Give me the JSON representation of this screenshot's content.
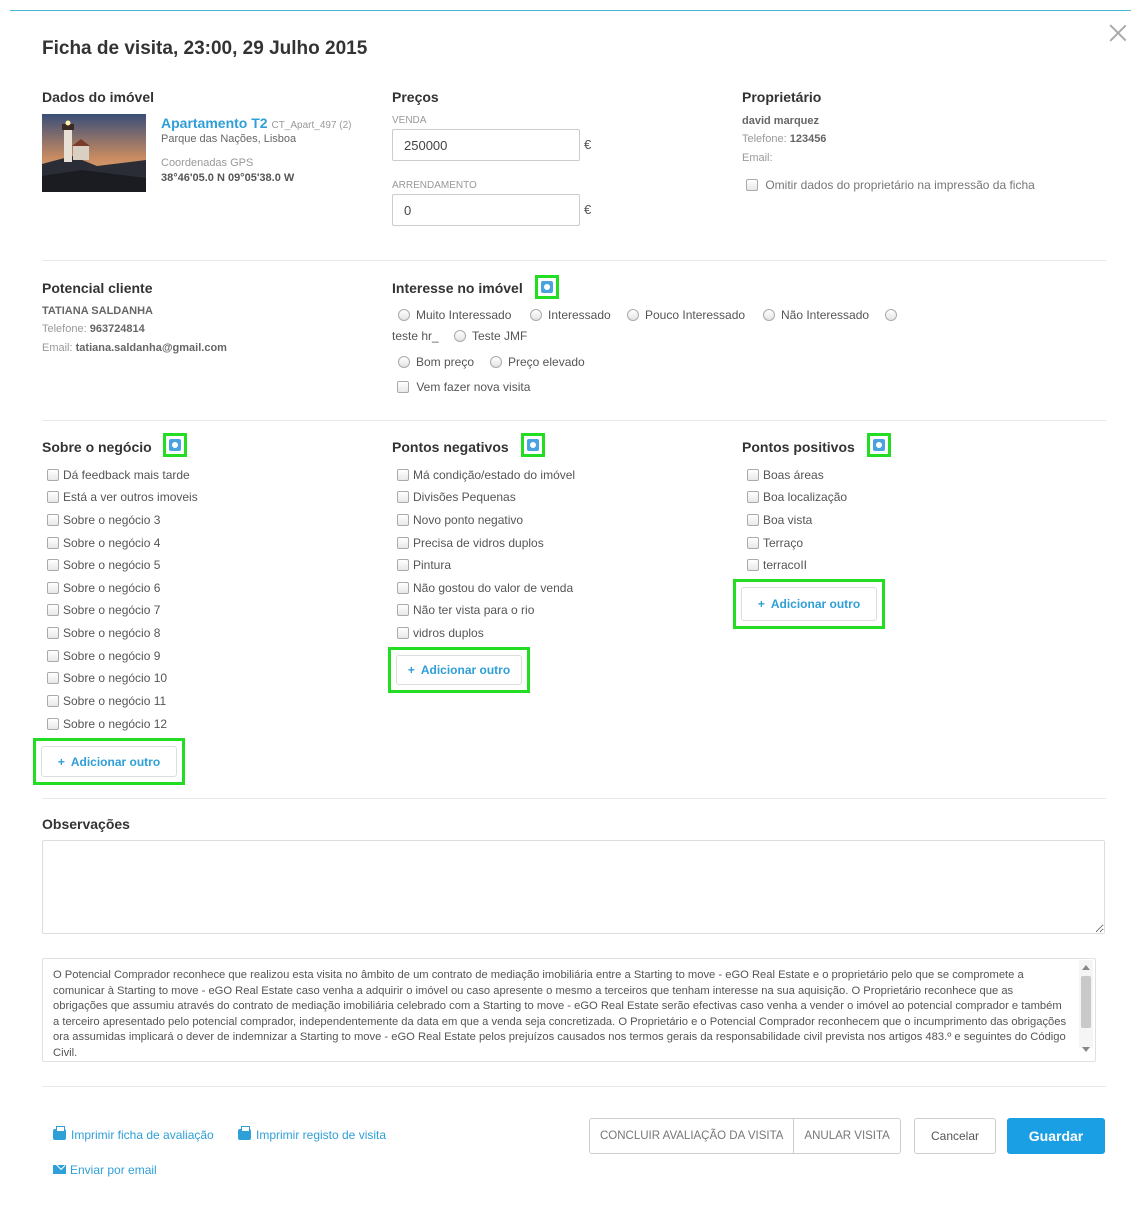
{
  "title": "Ficha de visita, 23:00, 29 Julho 2015",
  "property": {
    "heading": "Dados do imóvel",
    "name": "Apartamento T2",
    "code": "CT_Apart_497 (2)",
    "location": "Parque das Nações, Lisboa",
    "gps_label": "Coordenadas GPS",
    "gps_value": "38°46'05.0 N 09°05'38.0 W"
  },
  "prices": {
    "heading": "Preços",
    "sale_label": "VENDA",
    "sale_value": "250000",
    "rent_label": "ARRENDAMENTO",
    "rent_value": "0",
    "currency": "€"
  },
  "owner": {
    "heading": "Proprietário",
    "name": "david marquez",
    "phone_label": "Telefone:",
    "phone": "123456",
    "email_label": "Email:",
    "omit_label": "Omitir dados do proprietário na impressão da ficha"
  },
  "client": {
    "heading": "Potencial cliente",
    "name": "TATIANA SALDANHA",
    "phone_label": "Telefone:",
    "phone": "963724814",
    "email_label": "Email:",
    "email": "tatiana.saldanha@gmail.com"
  },
  "interest": {
    "heading": "Interesse no imóvel",
    "radios_row1": [
      "Muito Interessado",
      "Interessado",
      "Pouco Interessado",
      "Não Interessado"
    ],
    "radios_row2": [
      "teste hr_",
      "Teste JMF"
    ],
    "radios_row3": [
      "Bom preço",
      "Preço elevado"
    ],
    "checkbox": "Vem fazer nova visita"
  },
  "business": {
    "heading": "Sobre o negócio",
    "items": [
      "Dá feedback mais tarde",
      "Está a ver outros imoveis",
      "Sobre o negócio 3",
      "Sobre o negócio 4",
      "Sobre o negócio 5",
      "Sobre o negócio 6",
      "Sobre o negócio 7",
      "Sobre o negócio 8",
      "Sobre o negócio 9",
      "Sobre o negócio 10",
      "Sobre o negócio 11",
      "Sobre o negócio 12"
    ],
    "add_label": "Adicionar outro"
  },
  "negatives": {
    "heading": "Pontos negativos",
    "items": [
      "Má condição/estado do imóvel",
      "Divisões Pequenas",
      "Novo ponto negativo",
      "Precisa de vidros duplos",
      "Pintura",
      "Não gostou do valor de venda",
      "Não ter vista para o rio",
      "vidros duplos"
    ],
    "add_label": "Adicionar outro"
  },
  "positives": {
    "heading": "Pontos positivos",
    "items": [
      "Boas áreas",
      "Boa localização",
      "Boa vista",
      "Terraço",
      "terracoII"
    ],
    "add_label": "Adicionar outro"
  },
  "observations": {
    "heading": "Observações",
    "value": ""
  },
  "terms": {
    "text": "O Potencial Comprador reconhece que realizou esta visita no âmbito de um contrato de mediação imobiliária entre a Starting to move - eGO Real Estate  e o proprietário pelo que se compromete a comunicar à Starting to move - eGO Real Estate  caso venha a adquirir o imóvel ou caso apresente o mesmo a terceiros que tenham interesse na sua aquisição. O Proprietário reconhece que as obrigações que assumiu através do contrato de mediação imobiliária celebrado com a Starting to move - eGO Real Estate  serão efectivas caso venha a vender o imóvel ao potencial comprador e também a terceiro apresentado pelo potencial comprador, independentemente da data em que a venda seja concretizada. O Proprietário e o Potencial Comprador reconhecem que o incumprimento das obrigações ora assumidas implicará o dever de indemnizar a Starting to move - eGO Real Estate  pelos prejuízos causados nos termos gerais da responsabilidade civil prevista nos artigos 483.º e seguintes do Código Civil."
  },
  "footer": {
    "print_evaluation": "Imprimir ficha de avaliação",
    "print_visit": "Imprimir registo de visita",
    "send_email": "Enviar por email",
    "conclude": "CONCLUIR AVALIAÇÃO DA VISITA",
    "cancel_visit": "ANULAR VISITA",
    "cancel": "Cancelar",
    "save": "Guardar"
  }
}
